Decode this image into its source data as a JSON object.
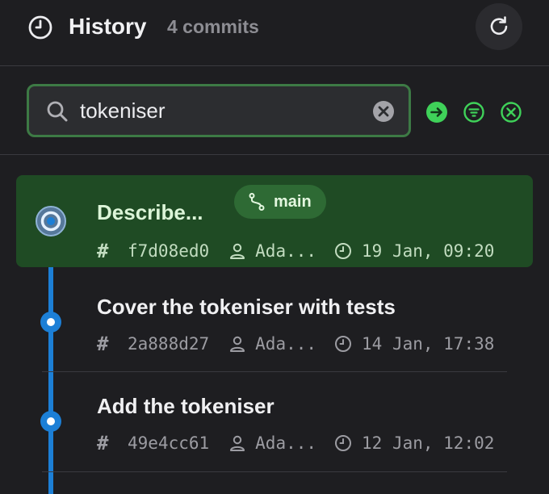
{
  "header": {
    "title": "History",
    "commit_count": "4 commits"
  },
  "search": {
    "value": "tokeniser"
  },
  "commits": [
    {
      "title": "Describe...",
      "hash": "f7d08ed0",
      "author": "Ada...",
      "date": "19 Jan, 09:20",
      "branch": "main",
      "selected": true
    },
    {
      "title": "Cover the tokeniser with tests",
      "hash": "2a888d27",
      "author": "Ada...",
      "date": "14 Jan, 17:38"
    },
    {
      "title": "Add the tokeniser",
      "hash": "49e4cc61",
      "author": "Ada...",
      "date": "12 Jan, 12:02"
    }
  ],
  "colors": {
    "accent_green": "#3fd159",
    "timeline_blue": "#1c7fd6",
    "selected_bg": "#1f4b24"
  }
}
